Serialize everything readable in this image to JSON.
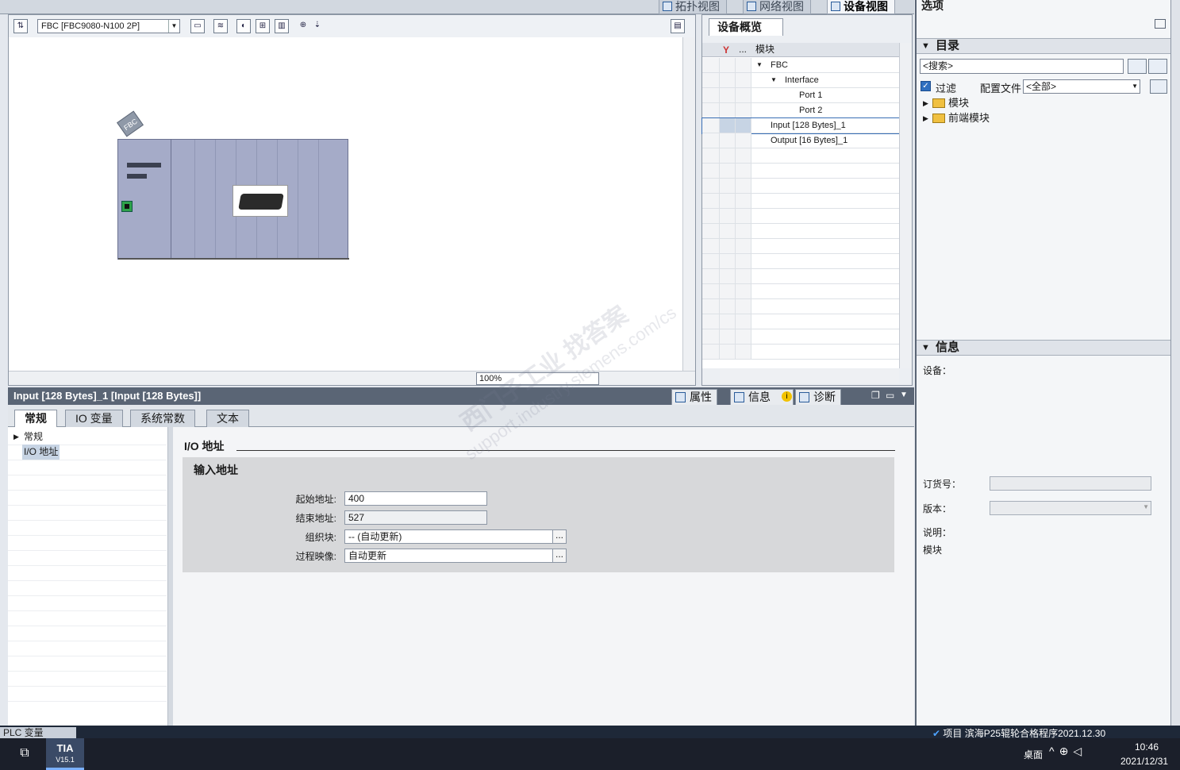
{
  "view_tabs": [
    "拓扑视图",
    "网络视图",
    "设备视图"
  ],
  "editor": {
    "device_select": "FBC [FBC9080-N100 2P]",
    "zoom": "100%",
    "rack_tag": "FBC"
  },
  "overview": {
    "tab": "设备概览",
    "col_more": "...",
    "col_module": "模块",
    "rows": [
      {
        "label": "FBC",
        "expand": "▼"
      },
      {
        "label": "Interface",
        "expand": "▼"
      },
      {
        "label": "Port 1"
      },
      {
        "label": "Port 2"
      },
      {
        "label": "Input [128 Bytes]_1"
      },
      {
        "label": "Output [16 Bytes]_1"
      }
    ]
  },
  "properties": {
    "title": "Input [128 Bytes]_1 [Input [128 Bytes]]",
    "tabs": [
      "属性",
      "信息",
      "诊断"
    ],
    "info_badge": "i",
    "subtabs": [
      "常规",
      "IO 变量",
      "系统常数",
      "文本"
    ],
    "nav": [
      "常规",
      "I/O 地址"
    ],
    "section_title": "I/O 地址",
    "subsection_title": "输入地址",
    "fields": {
      "start_label": "起始地址:",
      "start_value": "400",
      "end_label": "结束地址:",
      "end_value": "527",
      "ob_label": "组织块:",
      "ob_value": "-- (自动更新)",
      "pi_label": "过程映像:",
      "pi_value": "自动更新",
      "dots": "..."
    }
  },
  "right_panel": {
    "options_title": "选项",
    "catalog_title": "目录",
    "search_placeholder": "<搜索>",
    "filter_label": "过滤",
    "profile_label": "配置文件",
    "profile_value": "<全部>",
    "tree": [
      "模块",
      "前端模块"
    ],
    "info_title": "信息",
    "device_label": "设备：",
    "order_label": "订货号：",
    "version_label": "版本：",
    "desc_label": "说明：",
    "desc_value": "模块"
  },
  "status": {
    "plc_tab": "PLC 变量",
    "project": "项目 滨海P25辊轮合格程序2021.12.30"
  },
  "taskbar": {
    "app": "TIA",
    "app_version": "V15.1",
    "desktop": "桌面",
    "time": "10:46",
    "date": "2021/12/31"
  },
  "watermark": {
    "line1": "西门子工业  找答案",
    "line2": "support.industry.siemens.com/cs"
  }
}
